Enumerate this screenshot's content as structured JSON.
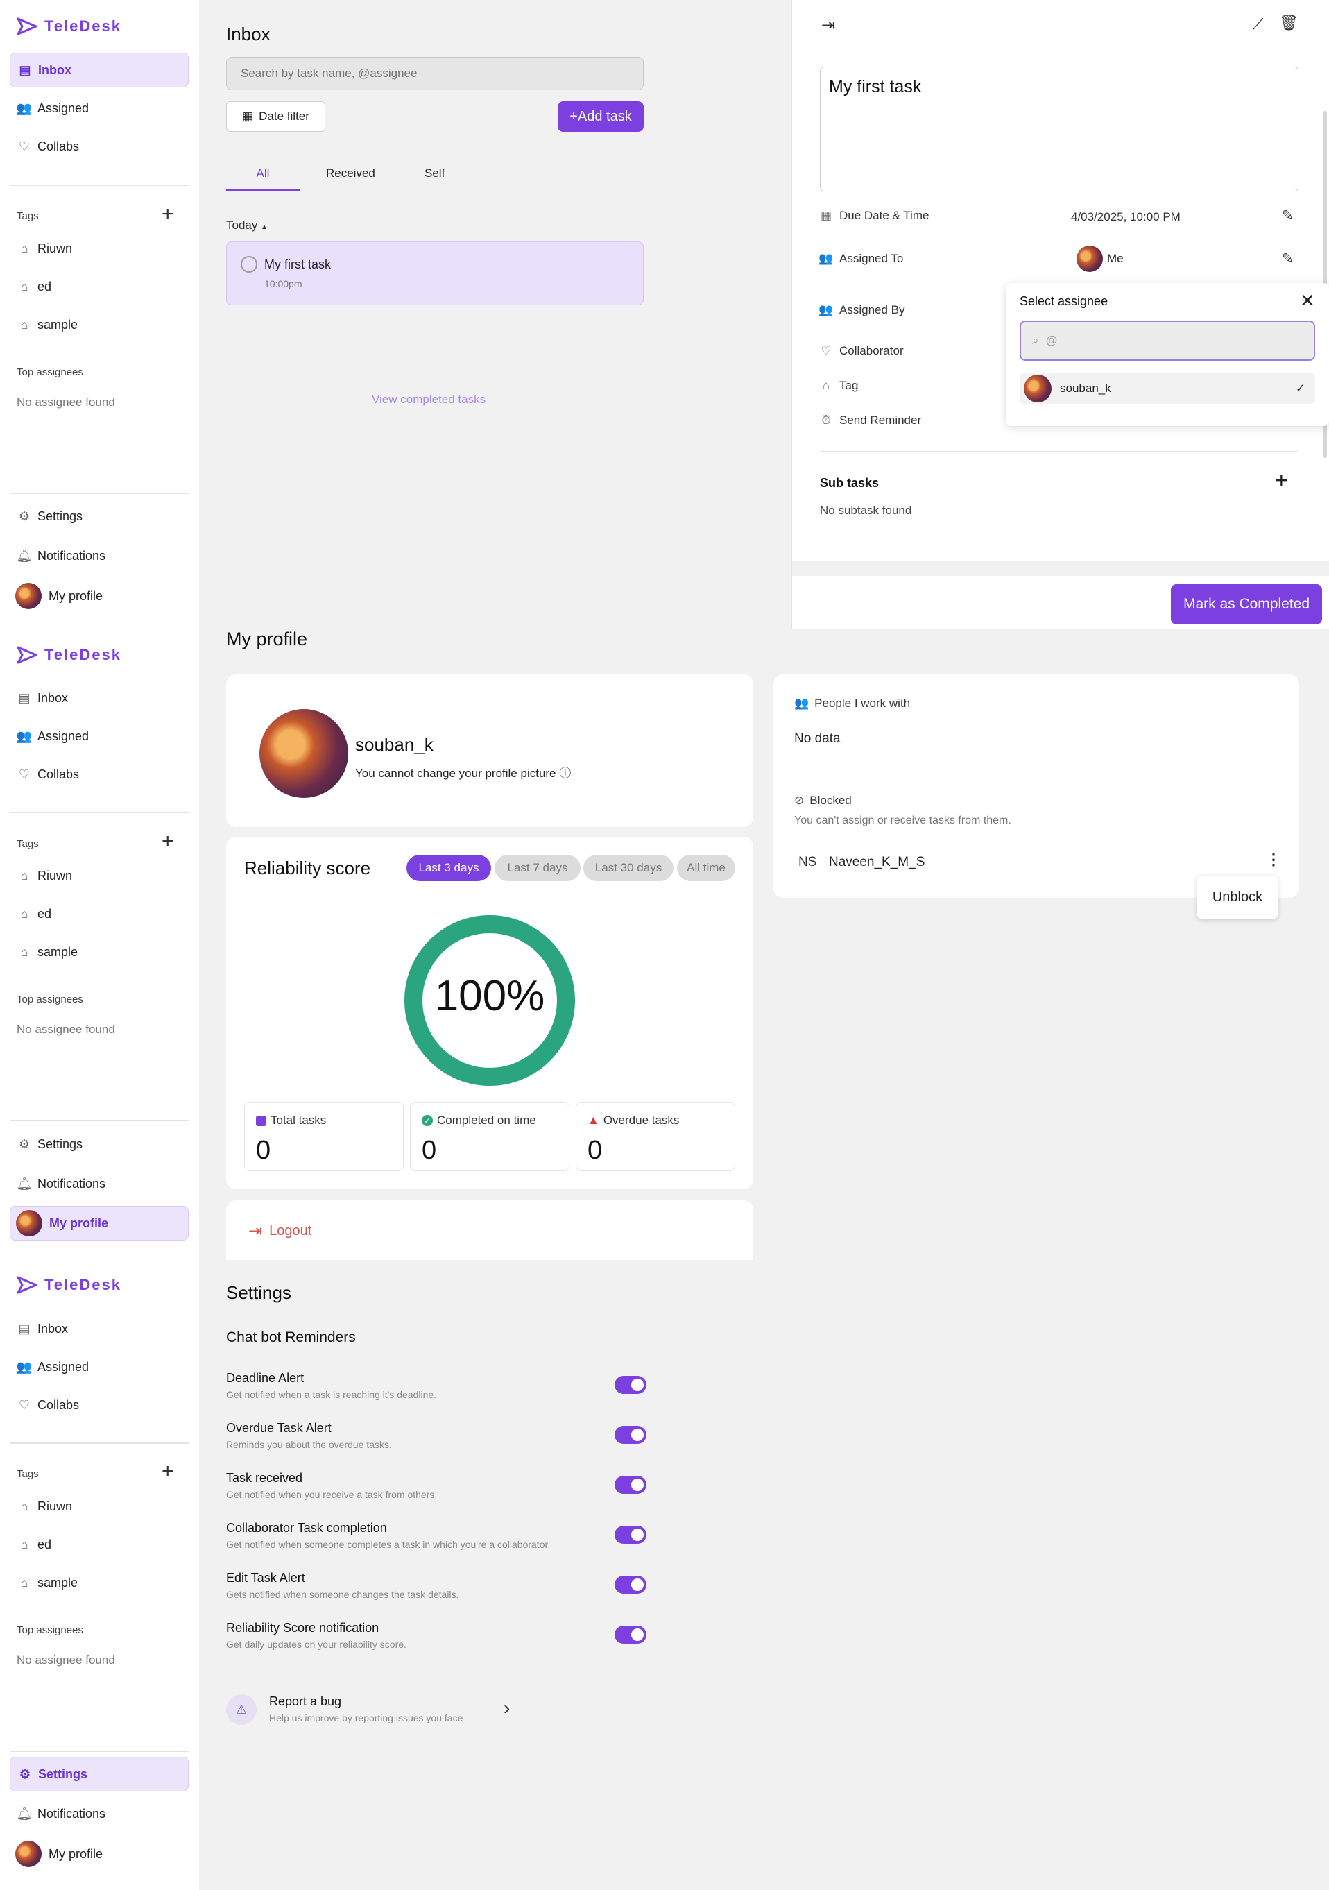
{
  "app": {
    "name": "TeleDesk"
  },
  "sidebar": {
    "inbox": "Inbox",
    "assigned": "Assigned",
    "collabs": "Collabs",
    "tags_label": "Tags",
    "tags": [
      "Riuwn",
      "ed",
      "sample"
    ],
    "top_assignees_label": "Top assignees",
    "no_assignee": "No assignee found",
    "settings": "Settings",
    "notifications": "Notifications",
    "my_profile": "My profile"
  },
  "inbox": {
    "title": "Inbox",
    "search_placeholder": "Search by task name, @assignee",
    "date_filter": "Date filter",
    "add_task": "+Add task",
    "tabs": [
      "All",
      "Received",
      "Self"
    ],
    "active_tab": "All",
    "group_label": "Today",
    "task": {
      "title": "My first task",
      "time": "10:00pm"
    },
    "view_completed": "View completed tasks"
  },
  "task_detail": {
    "title": "My first task",
    "due_label": "Due Date & Time",
    "due_value": "4/03/2025, 10:00 PM",
    "assigned_to_label": "Assigned To",
    "assigned_to_value": "Me",
    "assigned_by_label": "Assigned By",
    "collaborator_label": "Collaborator",
    "tag_label": "Tag",
    "reminder_label": "Send Reminder",
    "subtasks_label": "Sub tasks",
    "no_subtask": "No subtask found",
    "mark_completed": "Mark as Completed"
  },
  "assignee_popup": {
    "title": "Select assignee",
    "search_value": "@",
    "option": "souban_k"
  },
  "profile": {
    "title": "My profile",
    "username": "souban_k",
    "picture_note": "You cannot change your profile picture",
    "reliability_title": "Reliability score",
    "ranges": [
      "Last 3 days",
      "Last 7 days",
      "Last 30 days",
      "All time"
    ],
    "active_range": "Last 3 days",
    "score": "100%",
    "score_value": 100,
    "stats": [
      {
        "label": "Total tasks",
        "value": "0"
      },
      {
        "label": "Completed on time",
        "value": "0"
      },
      {
        "label": "Overdue tasks",
        "value": "0"
      }
    ],
    "logout": "Logout",
    "people_label": "People I work with",
    "no_data": "No data",
    "blocked_label": "Blocked",
    "blocked_desc": "You can't assign or receive tasks from them.",
    "blocked_user_initials": "NS",
    "blocked_user": "Naveen_K_M_S",
    "unblock": "Unblock"
  },
  "settings": {
    "title": "Settings",
    "section": "Chat bot Reminders",
    "items": [
      {
        "title": "Deadline Alert",
        "desc": "Get notified when a task is reaching it's deadline.",
        "on": true
      },
      {
        "title": "Overdue Task Alert",
        "desc": "Reminds you about the overdue tasks.",
        "on": true
      },
      {
        "title": "Task received",
        "desc": "Get notified when you receive a task from others.",
        "on": true
      },
      {
        "title": "Collaborator Task completion",
        "desc": "Get notified when someone completes a task in which you're a collaborator.",
        "on": true
      },
      {
        "title": "Edit Task Alert",
        "desc": "Gets notified when someone changes the task details.",
        "on": true
      },
      {
        "title": "Reliability Score notification",
        "desc": "Get daily updates on your reliability score.",
        "on": true
      }
    ],
    "bug_title": "Report a bug",
    "bug_desc": "Help us improve by reporting issues you face"
  },
  "colors": {
    "accent": "#7c3fe0",
    "score_ring": "#2aa57e",
    "logout": "#d9534f"
  }
}
